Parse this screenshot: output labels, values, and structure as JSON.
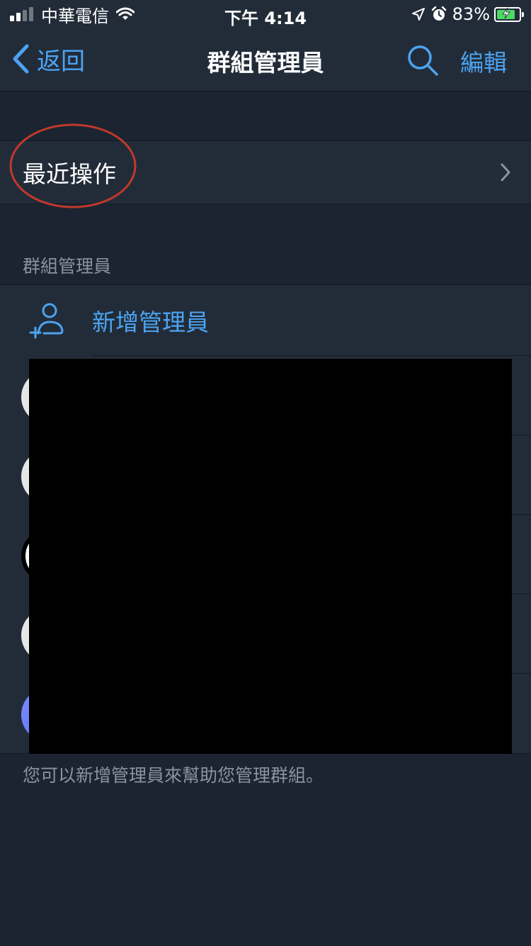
{
  "status_bar": {
    "carrier": "中華電信",
    "time": "下午 4:14",
    "battery_percent": "83%",
    "battery_level": 0.83,
    "signal_bars_filled": 2,
    "signal_bars_total": 4
  },
  "nav": {
    "back_label": "返回",
    "title": "群組管理員",
    "edit_label": "編輯"
  },
  "recent_actions": {
    "label": "最近操作"
  },
  "admins_section": {
    "header": "群組管理員",
    "add_admin_label": "新增管理員",
    "footer_note": "您可以新增管理員來幫助您管理群組。"
  },
  "colors": {
    "accent": "#4ca3f1",
    "background": "#1b2430",
    "row_background": "#222c39",
    "secondary_text": "#8a939e",
    "annotation": "#c0392b",
    "battery_fill": "#4cd964"
  },
  "icons": {
    "back": "chevron-left-icon",
    "search": "search-icon",
    "disclosure": "chevron-right-icon",
    "add_admin": "add-person-icon",
    "location": "location-arrow-icon",
    "alarm": "alarm-clock-icon",
    "wifi": "wifi-icon",
    "battery": "battery-charging-icon"
  }
}
